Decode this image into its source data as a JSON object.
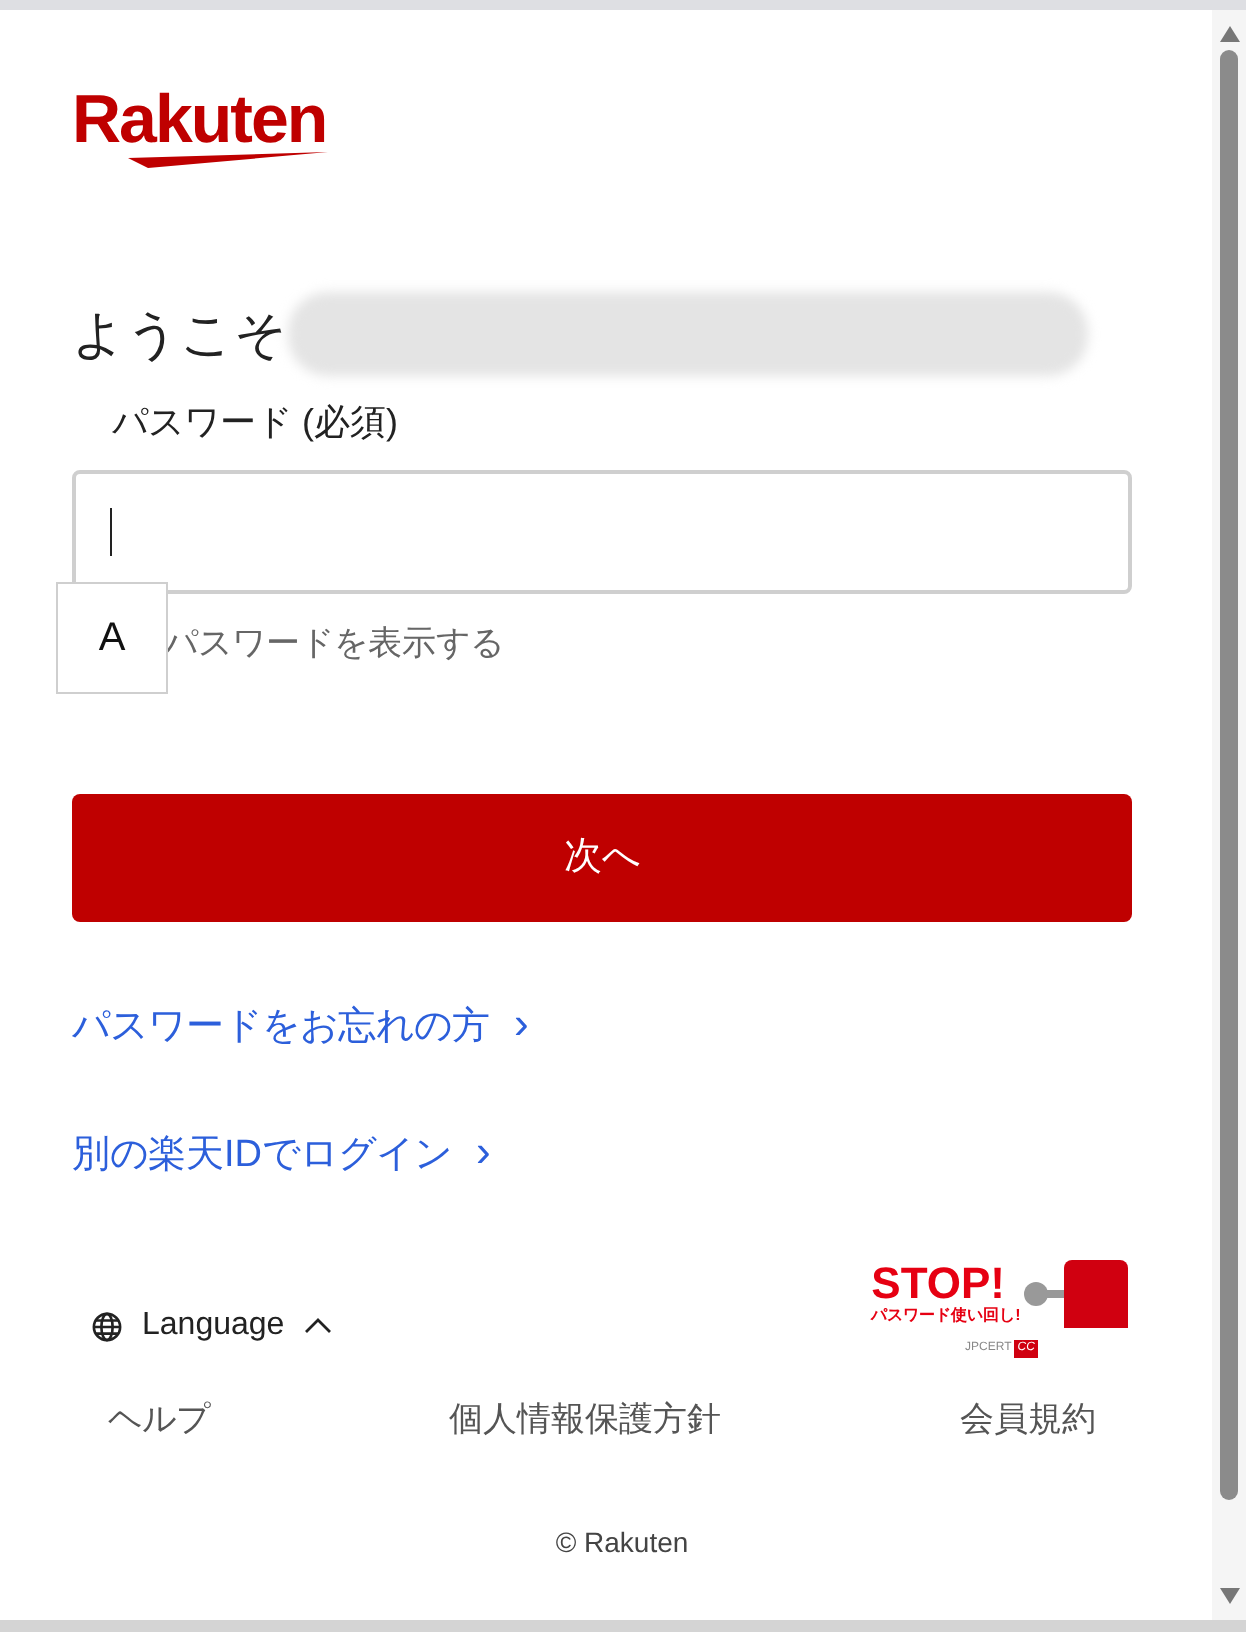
{
  "logo": {
    "text": "Rakuten"
  },
  "greeting": "ようこそ",
  "password": {
    "label": "パスワード (必須)",
    "ime_indicator": "A",
    "show_password_label": "パスワードを表示する"
  },
  "next_button": "次へ",
  "links": [
    {
      "label": "パスワードをお忘れの方",
      "chevron": "›"
    },
    {
      "label": "別の楽天IDでログイン",
      "chevron": "›"
    }
  ],
  "language": {
    "label": "Language",
    "expanded": true
  },
  "stop_banner": {
    "title": "STOP!",
    "subtitle": "パスワード使い回し!",
    "credit": "JPCERT",
    "credit_badge": "CC"
  },
  "footer_links": [
    "ヘルプ",
    "個人情報保護方針",
    "会員規約"
  ],
  "copyright": "© Rakuten"
}
